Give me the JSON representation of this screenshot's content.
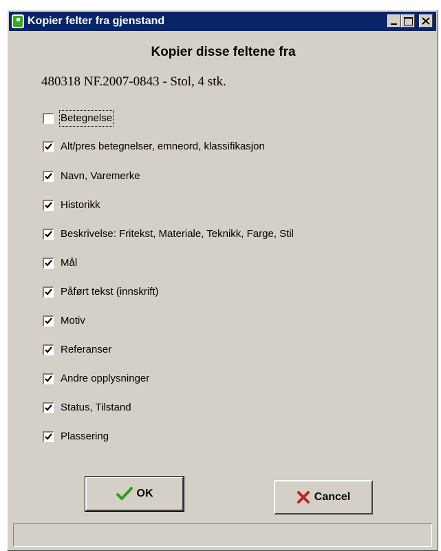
{
  "window": {
    "title": "Kopier felter fra gjenstand"
  },
  "dialog": {
    "heading": "Kopier disse feltene fra",
    "item": "480318 NF.2007-0843 - Stol, 4 stk."
  },
  "fields": [
    {
      "label": "Betegnelse",
      "checked": false
    },
    {
      "label": "Alt/pres betegnelser, emneord, klassifikasjon",
      "checked": true
    },
    {
      "label": "Navn, Varemerke",
      "checked": true
    },
    {
      "label": "Historikk",
      "checked": true
    },
    {
      "label": "Beskrivelse: Fritekst, Materiale, Teknikk, Farge, Stil",
      "checked": true
    },
    {
      "label": "Mål",
      "checked": true
    },
    {
      "label": "Påført tekst (innskrift)",
      "checked": true
    },
    {
      "label": "Motiv",
      "checked": true
    },
    {
      "label": "Referanser",
      "checked": true
    },
    {
      "label": "Andre opplysninger",
      "checked": true
    },
    {
      "label": "Status, Tilstand",
      "checked": true
    },
    {
      "label": "Plassering",
      "checked": true
    }
  ],
  "buttons": {
    "ok": "OK",
    "cancel": "Cancel"
  },
  "status": {
    "text": ""
  },
  "colors": {
    "titlebar": "#0a246a",
    "face": "#d4d0c8",
    "app_icon": "#3aa81f",
    "ok_check": "#2e9e1a",
    "cancel_x": "#c0241c"
  },
  "icons": {
    "app": "app-icon",
    "ok": "check-icon",
    "cancel": "x-icon"
  }
}
